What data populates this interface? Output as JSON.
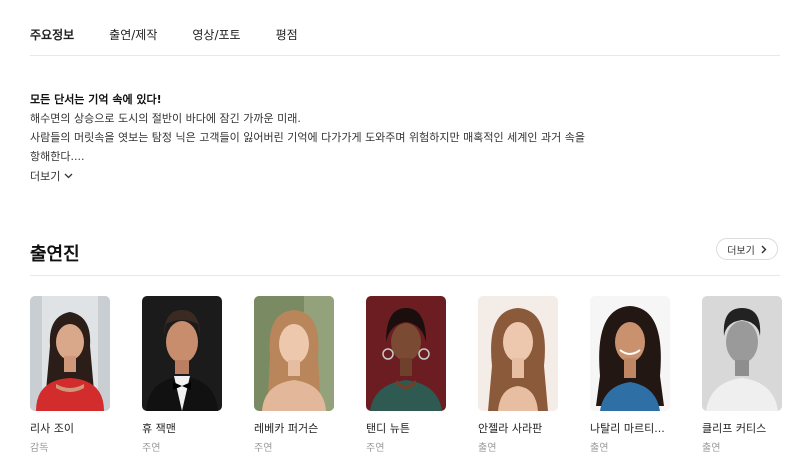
{
  "tabs": [
    {
      "label": "주요정보",
      "active": true
    },
    {
      "label": "출연/제작",
      "active": false
    },
    {
      "label": "영상/포토",
      "active": false
    },
    {
      "label": "평점",
      "active": false
    }
  ],
  "synopsis": {
    "headline": "모든 단서는 기억 속에 있다!",
    "lines": [
      "해수면의 상승으로 도시의 절반이 바다에 잠긴 가까운 미래.",
      "사람들의 머릿속을 엿보는 탐정 닉은 고객들이 잃어버린 기억에 다가가게 도와주며 위험하지만 매혹적인 세계인 과거 속을",
      "항해한다...."
    ],
    "more_label": "더보기"
  },
  "cast_section": {
    "title": "출연진",
    "more_label": "더보기"
  },
  "cast": [
    {
      "name": "리사 조이",
      "role": "감독",
      "icon": "portrait-woman-dark-hair-red-dress"
    },
    {
      "name": "휴 잭맨",
      "role": "주연",
      "icon": "portrait-man-tuxedo"
    },
    {
      "name": "레베카 퍼거슨",
      "role": "주연",
      "icon": "portrait-woman-blonde"
    },
    {
      "name": "탠디 뉴튼",
      "role": "주연",
      "icon": "portrait-woman-earrings"
    },
    {
      "name": "안젤라 사라판",
      "role": "출연",
      "icon": "portrait-woman-long-brown-hair"
    },
    {
      "name": "나탈리 마르티...",
      "role": "출연",
      "icon": "portrait-woman-curly-hair"
    },
    {
      "name": "클리프 커티스",
      "role": "출연",
      "icon": "portrait-man-grayscale"
    }
  ],
  "colors": {
    "text": "#222222",
    "muted": "#999999",
    "divider": "#e8e8e8"
  }
}
